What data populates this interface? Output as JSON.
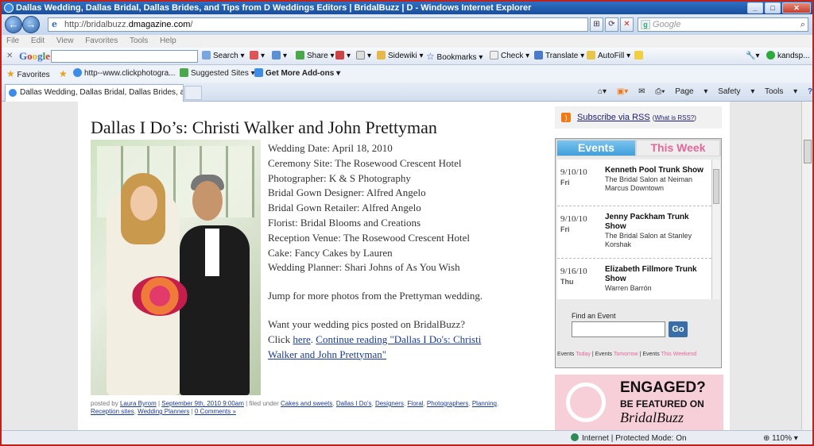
{
  "window": {
    "title": "Dallas Wedding, Dallas Bridal, Dallas Brides, and Tips from D Weddings Editors | BridalBuzz | D - Windows Internet Explorer"
  },
  "address": {
    "prefix": "http://bridalbuzz.",
    "domain": "dmagazine.com",
    "suffix": "/"
  },
  "search": {
    "placeholder": "Google"
  },
  "menu": [
    "File",
    "Edit",
    "View",
    "Favorites",
    "Tools",
    "Help"
  ],
  "google_toolbar": {
    "logo": "Google",
    "search_label": "Search",
    "share_label": "Share",
    "sidewiki_label": "Sidewiki",
    "bookmarks_label": "Bookmarks",
    "check_label": "Check",
    "translate_label": "Translate",
    "autofill_label": "AutoFill",
    "user": "kandsp..."
  },
  "favorites_bar": {
    "favorites_label": "Favorites",
    "link1": "http--www.clickphotogra...",
    "suggested": "Suggested Sites",
    "addons": "Get More Add-ons"
  },
  "tab": {
    "label": "Dallas Wedding, Dallas Bridal, Dallas Brides, and T..."
  },
  "commandbar": {
    "page": "Page",
    "safety": "Safety",
    "tools": "Tools"
  },
  "post": {
    "title": "Dallas I Do’s: Christi Walker and John Prettyman",
    "details": [
      "Wedding Date: April 18, 2010",
      "Ceremony Site: The Rosewood Crescent Hotel",
      "Photographer: K & S Photography",
      "Bridal Gown Designer: Alfred Angelo",
      "Bridal Gown Retailer: Alfred Angelo",
      "Florist: Bridal Blooms and Creations",
      "Reception Venue: The Rosewood Crescent Hotel",
      "Cake: Fancy Cakes by Lauren",
      "Wedding Planner: Shari Johns of As You Wish"
    ],
    "jump_text": "Jump for more photos from the Prettyman wedding.",
    "cta_line1": "Want your wedding pics posted on BridalBuzz?",
    "cta_click": "Click",
    "cta_here": "here",
    "continue_link": "Continue reading \"Dallas I Do's: Christi Walker and John Prettyman\"",
    "meta": {
      "posted_by": "posted by",
      "author": "Laura Byrom",
      "date": "September 9th, 2010 9:00am",
      "filed_under": "filed under",
      "categories": [
        "Cakes and sweets",
        "Dallas I Do's",
        "Designers",
        "Floral",
        "Photographers",
        "Planning",
        "Reception sites",
        "Wedding Planners"
      ],
      "comments": "0 Comments »"
    }
  },
  "sidebar": {
    "rss_label": "Subscribe via RSS",
    "rss_what": "What is RSS?",
    "events_tab": "Events",
    "thisweek_tab": "This Week",
    "events": [
      {
        "date": "9/10/10",
        "day": "Fri",
        "name": "Kenneth Pool Trunk Show",
        "location": "The Bridal Salon at Neiman Marcus Downtown"
      },
      {
        "date": "9/10/10",
        "day": "Fri",
        "name": "Jenny Packham Trunk Show",
        "location": "The Bridal Salon at Stanley Korshak"
      },
      {
        "date": "9/16/10",
        "day": "Thu",
        "name": "Elizabeth Fillmore Trunk Show",
        "location": "Warren Barrón"
      }
    ],
    "find_label": "Find an Event",
    "go_label": "Go",
    "links": {
      "a": "Events",
      "b": "Today",
      "c": "Events",
      "d": "Tomorrow",
      "e": "Events",
      "f": "This Weekend"
    },
    "banner": {
      "line1": "ENGAGED?",
      "line2": "BE FEATURED ON",
      "line3": "BridalBuzz"
    }
  },
  "status": {
    "zone": "Internet | Protected Mode: On",
    "zoom": "110%"
  }
}
